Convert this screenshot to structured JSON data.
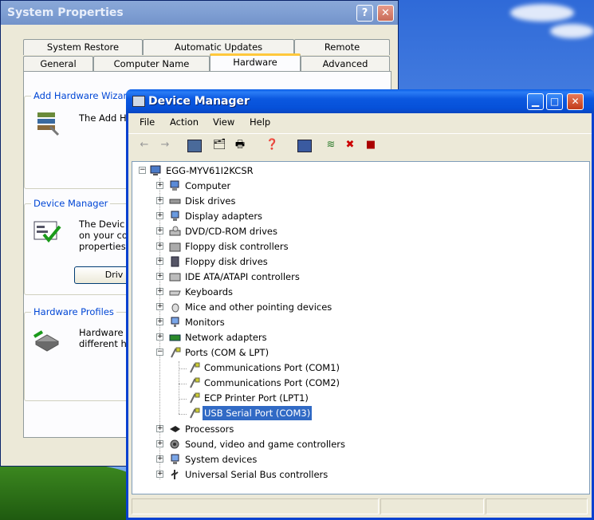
{
  "system_properties": {
    "title": "System Properties",
    "help_label": "?",
    "close_label": "✕",
    "tabs_row1": [
      "System Restore",
      "Automatic Updates",
      "Remote"
    ],
    "tabs_row2": [
      "General",
      "Computer Name",
      "Hardware",
      "Advanced"
    ],
    "active_tab": "Hardware",
    "groups": {
      "add_hardware": {
        "label": "Add Hardware Wizard",
        "text": "The Add H"
      },
      "device_manager": {
        "label": "Device Manager",
        "text": "The Devic\non your co\nproperties",
        "button": "Driv"
      },
      "hardware_profiles": {
        "label": "Hardware Profiles",
        "text": "Hardware p\ndifferent h"
      }
    }
  },
  "device_manager": {
    "title": "Device Manager",
    "menu": [
      "File",
      "Action",
      "View",
      "Help"
    ],
    "root": "EGG-MYV61I2KCSR",
    "categories": [
      "Computer",
      "Disk drives",
      "Display adapters",
      "DVD/CD-ROM drives",
      "Floppy disk controllers",
      "Floppy disk drives",
      "IDE ATA/ATAPI controllers",
      "Keyboards",
      "Mice and other pointing devices",
      "Monitors",
      "Network adapters",
      "Ports (COM & LPT)"
    ],
    "ports": [
      "Communications Port (COM1)",
      "Communications Port (COM2)",
      "ECP Printer Port (LPT1)",
      "USB Serial Port (COM3)"
    ],
    "selected": "USB Serial Port (COM3)",
    "categories_after": [
      "Processors",
      "Sound, video and game controllers",
      "System devices",
      "Universal Serial Bus controllers"
    ]
  },
  "colors": {
    "selection": "#316ac5",
    "titlebar": "#0650d8",
    "group_label": "#0046d5"
  }
}
